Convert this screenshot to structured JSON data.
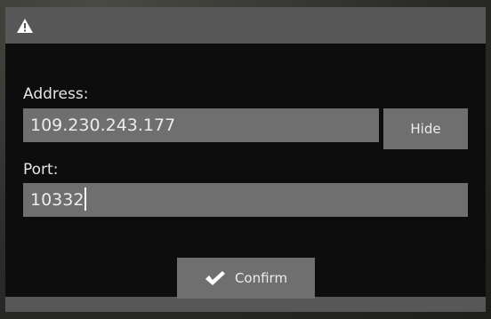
{
  "dialog": {
    "title_icon": "warning-icon",
    "address_label": "Address:",
    "address_value": "109.230.243.177",
    "hide_label": "Hide",
    "port_label": "Port:",
    "port_value": "10332",
    "confirm_icon": "checkmark-icon",
    "confirm_label": "Confirm"
  }
}
